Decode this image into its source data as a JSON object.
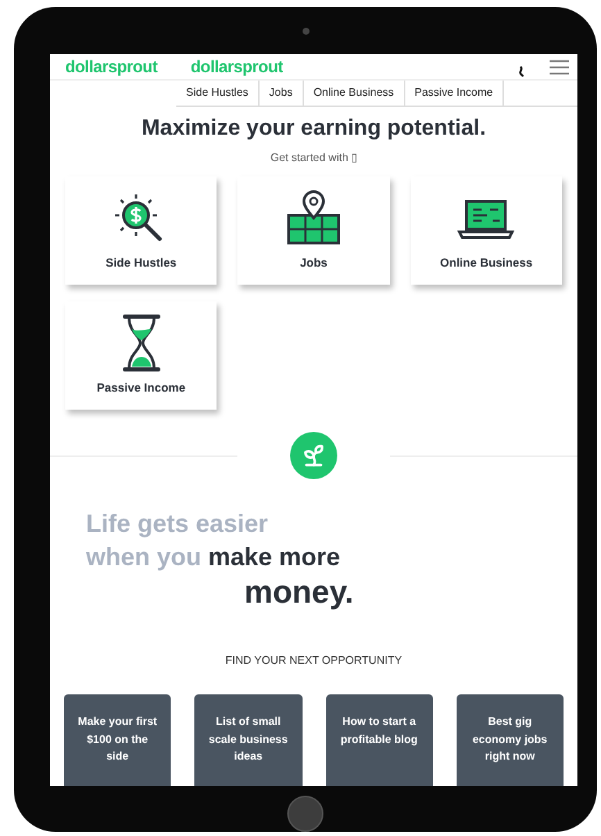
{
  "header": {
    "logos": [
      "dollarsprout",
      "dollarsprout"
    ]
  },
  "menu": {
    "items": [
      {
        "label": "Side Hustles"
      },
      {
        "label": "Jobs"
      },
      {
        "label": "Online Business"
      },
      {
        "label": "Passive Income"
      }
    ]
  },
  "hero": {
    "title": "Maximize your earning potential.",
    "subtitle": "Get started with ▯"
  },
  "categories": [
    {
      "kind": "magnifier",
      "label": "Side Hustles"
    },
    {
      "kind": "map",
      "label": "Jobs"
    },
    {
      "kind": "laptop",
      "label": "Online Business"
    },
    {
      "kind": "hourglass",
      "label": "Passive Income"
    }
  ],
  "tagline": {
    "muted_1": "Life gets easier",
    "muted_2": "when you",
    "strong_1": "make more",
    "strong_2": "money."
  },
  "opportunities": {
    "heading": "FIND YOUR NEXT OPPORTUNITY",
    "articles": [
      {
        "title": "Make your first $100 on the side"
      },
      {
        "title": "List of small scale business ideas"
      },
      {
        "title": "How to start a profitable blog"
      },
      {
        "title": "Best gig economy jobs right now"
      }
    ]
  }
}
